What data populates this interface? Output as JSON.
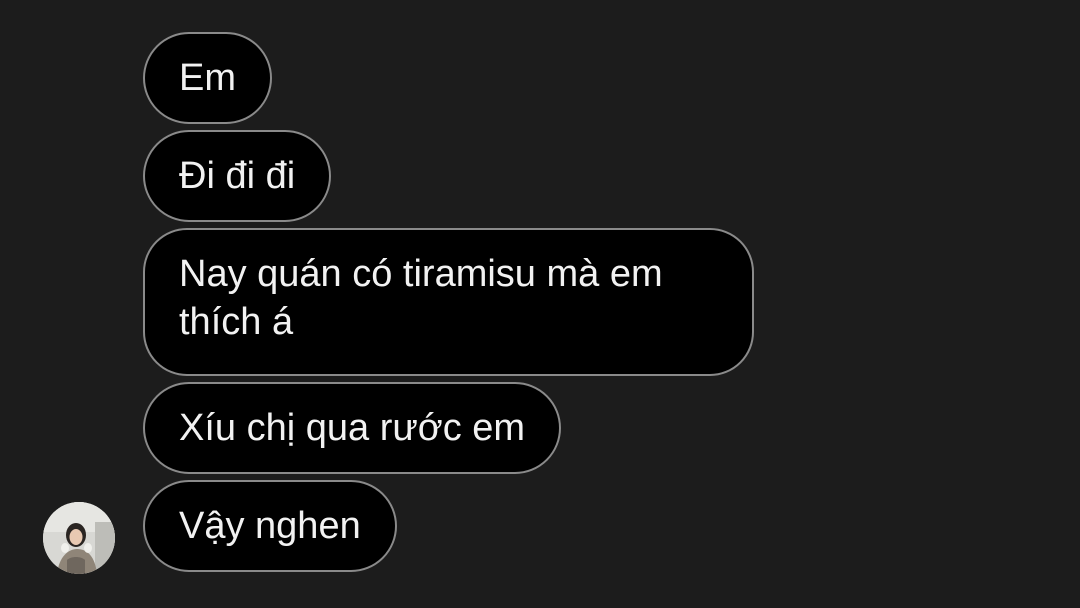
{
  "messages": [
    {
      "text": "Em"
    },
    {
      "text": "Đi đi đi"
    },
    {
      "text": "Nay quán có tiramisu mà em thích á"
    },
    {
      "text": "Xíu chị qua rước em"
    },
    {
      "text": "Vậy nghen"
    }
  ],
  "sender": {
    "avatar_icon": "profile-photo-avatar"
  },
  "colors": {
    "background": "#1c1c1c",
    "bubble_fill": "#000000",
    "bubble_border": "#8a8a8a",
    "text": "#f2f2f2"
  }
}
